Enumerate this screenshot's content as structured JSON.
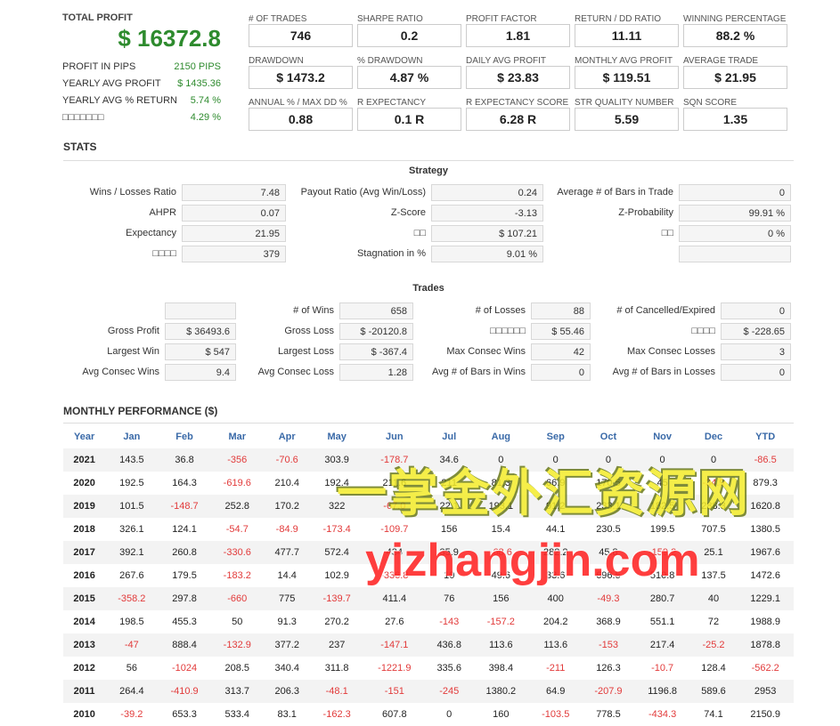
{
  "summary": {
    "total_label": "TOTAL PROFIT",
    "total_value": "$ 16372.8",
    "rows": [
      {
        "label": "PROFIT IN PIPS",
        "value": "2150 PIPS"
      },
      {
        "label": "YEARLY AVG PROFIT",
        "value": "$ 1435.36"
      },
      {
        "label": "YEARLY AVG % RETURN",
        "value": "5.74 %"
      },
      {
        "label": "□□□□□□□",
        "value": "4.29 %"
      }
    ]
  },
  "metrics": [
    {
      "label": "# OF TRADES",
      "value": "746"
    },
    {
      "label": "SHARPE RATIO",
      "value": "0.2"
    },
    {
      "label": "PROFIT FACTOR",
      "value": "1.81"
    },
    {
      "label": "RETURN / DD RATIO",
      "value": "11.11"
    },
    {
      "label": "WINNING PERCENTAGE",
      "value": "88.2 %"
    },
    {
      "label": "DRAWDOWN",
      "value": "$ 1473.2"
    },
    {
      "label": "% DRAWDOWN",
      "value": "4.87 %"
    },
    {
      "label": "DAILY AVG PROFIT",
      "value": "$ 23.83"
    },
    {
      "label": "MONTHLY AVG PROFIT",
      "value": "$ 119.51"
    },
    {
      "label": "AVERAGE TRADE",
      "value": "$ 21.95"
    },
    {
      "label": "ANNUAL % / MAX DD %",
      "value": "0.88"
    },
    {
      "label": "R EXPECTANCY",
      "value": "0.1 R"
    },
    {
      "label": "R EXPECTANCY SCORE",
      "value": "6.28 R"
    },
    {
      "label": "STR QUALITY NUMBER",
      "value": "5.59"
    },
    {
      "label": "SQN SCORE",
      "value": "1.35"
    }
  ],
  "stats_title": "STATS",
  "strategy": {
    "title": "Strategy",
    "rows": [
      [
        {
          "label": "Wins / Losses Ratio",
          "value": "7.48"
        },
        {
          "label": "Payout Ratio (Avg Win/Loss)",
          "value": "0.24"
        },
        {
          "label": "Average # of Bars in Trade",
          "value": "0"
        }
      ],
      [
        {
          "label": "AHPR",
          "value": "0.07"
        },
        {
          "label": "Z-Score",
          "value": "-3.13"
        },
        {
          "label": "Z-Probability",
          "value": "99.91 %"
        }
      ],
      [
        {
          "label": "Expectancy",
          "value": "21.95"
        },
        {
          "label": "□□",
          "value": "$ 107.21"
        },
        {
          "label": "□□",
          "value": "0 %"
        }
      ],
      [
        {
          "label": "□□□□",
          "value": "379"
        },
        {
          "label": "Stagnation in %",
          "value": "9.01 %"
        },
        {
          "label": "",
          "value": ""
        }
      ]
    ]
  },
  "trades": {
    "title": "Trades",
    "rows": [
      [
        {
          "label": "",
          "value": ""
        },
        {
          "label": "# of Wins",
          "value": "658"
        },
        {
          "label": "# of Losses",
          "value": "88"
        },
        {
          "label": "# of Cancelled/Expired",
          "value": "0"
        }
      ],
      [
        {
          "label": "Gross Profit",
          "value": "$ 36493.6"
        },
        {
          "label": "Gross Loss",
          "value": "$ -20120.8"
        },
        {
          "label": "□□□□□□",
          "value": "$ 55.46"
        },
        {
          "label": "□□□□",
          "value": "$ -228.65"
        }
      ],
      [
        {
          "label": "Largest Win",
          "value": "$ 547"
        },
        {
          "label": "Largest Loss",
          "value": "$ -367.4"
        },
        {
          "label": "Max Consec Wins",
          "value": "42"
        },
        {
          "label": "Max Consec Losses",
          "value": "3"
        }
      ],
      [
        {
          "label": "Avg Consec Wins",
          "value": "9.4"
        },
        {
          "label": "Avg Consec Loss",
          "value": "1.28"
        },
        {
          "label": "Avg # of Bars in Wins",
          "value": "0"
        },
        {
          "label": "Avg # of Bars in Losses",
          "value": "0"
        }
      ]
    ]
  },
  "monthly": {
    "title": "MONTHLY PERFORMANCE ($)",
    "headers": [
      "Year",
      "Jan",
      "Feb",
      "Mar",
      "Apr",
      "May",
      "Jun",
      "Jul",
      "Aug",
      "Sep",
      "Oct",
      "Nov",
      "Dec",
      "YTD"
    ],
    "rows": [
      [
        "2021",
        "143.5",
        "36.8",
        "-356",
        "-70.6",
        "303.9",
        "-178.7",
        "34.6",
        "0",
        "0",
        "0",
        "0",
        "0",
        "-86.5"
      ],
      [
        "2020",
        "192.5",
        "164.3",
        "-619.6",
        "210.4",
        "192.4",
        "211.6",
        "211",
        "81.3",
        "66.9",
        "170.5",
        "45",
        "-34.9",
        "879.3"
      ],
      [
        "2019",
        "101.5",
        "-148.7",
        "252.8",
        "170.2",
        "322",
        "-67.0",
        "22.1",
        "193.1",
        "91.2",
        "233.1",
        "182.5",
        "288.3",
        "1620.8"
      ],
      [
        "2018",
        "326.1",
        "124.1",
        "-54.7",
        "-84.9",
        "-173.4",
        "-109.7",
        "156",
        "15.4",
        "44.1",
        "230.5",
        "199.5",
        "707.5",
        "1380.5"
      ],
      [
        "2017",
        "392.1",
        "260.8",
        "-330.6",
        "477.7",
        "572.4",
        "434",
        "35.9",
        "-68.6",
        "282.2",
        "45.8",
        "-159.2",
        "25.1",
        "1967.6"
      ],
      [
        "2016",
        "267.6",
        "179.5",
        "-183.2",
        "14.4",
        "102.9",
        "-336.8",
        "10",
        "49.6",
        "33.6",
        "696.5",
        "510.8",
        "137.5",
        "1472.6"
      ],
      [
        "2015",
        "-358.2",
        "297.8",
        "-660",
        "775",
        "-139.7",
        "411.4",
        "76",
        "156",
        "400",
        "-49.3",
        "280.7",
        "40",
        "1229.1"
      ],
      [
        "2014",
        "198.5",
        "455.3",
        "50",
        "91.3",
        "270.2",
        "27.6",
        "-143",
        "-157.2",
        "204.2",
        "368.9",
        "551.1",
        "72",
        "1988.9"
      ],
      [
        "2013",
        "-47",
        "888.4",
        "-132.9",
        "377.2",
        "237",
        "-147.1",
        "436.8",
        "113.6",
        "113.6",
        "-153",
        "217.4",
        "-25.2",
        "1878.8"
      ],
      [
        "2012",
        "56",
        "-1024",
        "208.5",
        "340.4",
        "311.8",
        "-1221.9",
        "335.6",
        "398.4",
        "-211",
        "126.3",
        "-10.7",
        "128.4",
        "-562.2"
      ],
      [
        "2011",
        "264.4",
        "-410.9",
        "313.7",
        "206.3",
        "-48.1",
        "-151",
        "-245",
        "1380.2",
        "64.9",
        "-207.9",
        "1196.8",
        "589.6",
        "2953"
      ],
      [
        "2010",
        "-39.2",
        "653.3",
        "533.4",
        "83.1",
        "-162.3",
        "607.8",
        "0",
        "160",
        "-103.5",
        "778.5",
        "-434.3",
        "74.1",
        "2150.9"
      ]
    ]
  },
  "watermark": {
    "line1": "一掌金外汇资源网",
    "line2": "yizhangjin.com",
    "color1": "#f4ec2a",
    "color2": "#ff2a2a"
  },
  "colors": {
    "positive": "#2e8b2e",
    "negative": "#e23a3a",
    "header_blue": "#3a6aa8"
  }
}
